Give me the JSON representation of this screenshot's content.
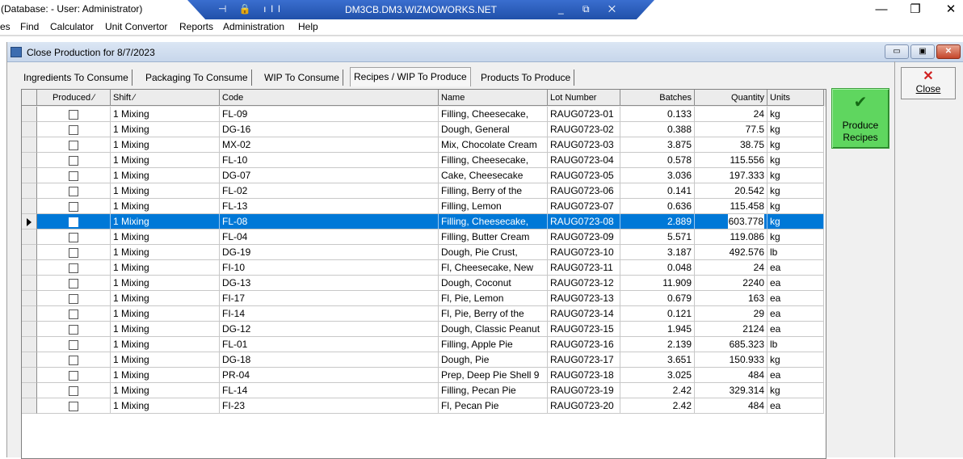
{
  "titlebar": {
    "text": "(Database:  - User: Administrator)",
    "remote_icons": "⊣ 🔒 ıll",
    "remote_host": "DM3CB.DM3.WIZMOWORKS.NET",
    "remote_controls": "_ ⧉ ✕",
    "minimize": "—",
    "restore": "❐",
    "close": "✕"
  },
  "menu": {
    "items": [
      "es",
      "Find",
      "Calculator",
      "Unit Convertor",
      "Reports",
      "Administration",
      "Help"
    ]
  },
  "child_window": {
    "title": "Close Production for 8/7/2023",
    "min": "▭",
    "max": "▣",
    "close": "✕"
  },
  "tabs": [
    {
      "label": "Ingredients To Consume"
    },
    {
      "label": "Packaging To Consume"
    },
    {
      "label": "WIP To Consume"
    },
    {
      "label": "Recipes / WIP To Produce"
    },
    {
      "label": "Products To Produce"
    }
  ],
  "grid": {
    "headers": {
      "produced": "Produced",
      "shift": "Shift",
      "code": "Code",
      "name": "Name",
      "lot": "Lot Number",
      "batches": "Batches",
      "quantity": "Quantity",
      "units": "Units"
    },
    "sort_glyph": "∕",
    "rows": [
      {
        "shift": "1 Mixing",
        "code": "FL-09",
        "name": "Filling, Cheesecake,",
        "lot": "RAUG0723-01",
        "batches": "0.133",
        "qty": "24",
        "units": "kg"
      },
      {
        "shift": "1 Mixing",
        "code": "DG-16",
        "name": "Dough, General",
        "lot": "RAUG0723-02",
        "batches": "0.388",
        "qty": "77.5",
        "units": "kg"
      },
      {
        "shift": "1 Mixing",
        "code": "MX-02",
        "name": "Mix, Chocolate Cream",
        "lot": "RAUG0723-03",
        "batches": "3.875",
        "qty": "38.75",
        "units": "kg"
      },
      {
        "shift": "1 Mixing",
        "code": "FL-10",
        "name": "Filling, Cheesecake,",
        "lot": "RAUG0723-04",
        "batches": "0.578",
        "qty": "115.556",
        "units": "kg"
      },
      {
        "shift": "1 Mixing",
        "code": "DG-07",
        "name": "Cake, Cheesecake",
        "lot": "RAUG0723-05",
        "batches": "3.036",
        "qty": "197.333",
        "units": "kg"
      },
      {
        "shift": "1 Mixing",
        "code": "FL-02",
        "name": "Filling, Berry of the",
        "lot": "RAUG0723-06",
        "batches": "0.141",
        "qty": "20.542",
        "units": "kg"
      },
      {
        "shift": "1 Mixing",
        "code": "FL-13",
        "name": "Filling, Lemon",
        "lot": "RAUG0723-07",
        "batches": "0.636",
        "qty": "115.458",
        "units": "kg"
      },
      {
        "shift": "1 Mixing",
        "code": "FL-08",
        "name": "Filling, Cheesecake,",
        "lot": "RAUG0723-08",
        "batches": "2.889",
        "qty": "603.778",
        "units": "kg",
        "selected": true
      },
      {
        "shift": "1 Mixing",
        "code": "FL-04",
        "name": "Filling, Butter Cream",
        "lot": "RAUG0723-09",
        "batches": "5.571",
        "qty": "119.086",
        "units": "kg"
      },
      {
        "shift": "1 Mixing",
        "code": "DG-19",
        "name": "Dough, Pie Crust,",
        "lot": "RAUG0723-10",
        "batches": "3.187",
        "qty": "492.576",
        "units": "lb"
      },
      {
        "shift": "1 Mixing",
        "code": "FI-10",
        "name": "Fl, Cheesecake, New",
        "lot": "RAUG0723-11",
        "batches": "0.048",
        "qty": "24",
        "units": "ea"
      },
      {
        "shift": "1 Mixing",
        "code": "DG-13",
        "name": "Dough, Coconut",
        "lot": "RAUG0723-12",
        "batches": "11.909",
        "qty": "2240",
        "units": "ea"
      },
      {
        "shift": "1 Mixing",
        "code": "FI-17",
        "name": "Fl, Pie, Lemon",
        "lot": "RAUG0723-13",
        "batches": "0.679",
        "qty": "163",
        "units": "ea"
      },
      {
        "shift": "1 Mixing",
        "code": "FI-14",
        "name": "Fl, Pie, Berry of the",
        "lot": "RAUG0723-14",
        "batches": "0.121",
        "qty": "29",
        "units": "ea"
      },
      {
        "shift": "1 Mixing",
        "code": "DG-12",
        "name": "Dough, Classic Peanut",
        "lot": "RAUG0723-15",
        "batches": "1.945",
        "qty": "2124",
        "units": "ea"
      },
      {
        "shift": "1 Mixing",
        "code": "FL-01",
        "name": "Filling, Apple Pie",
        "lot": "RAUG0723-16",
        "batches": "2.139",
        "qty": "685.323",
        "units": "lb"
      },
      {
        "shift": "1 Mixing",
        "code": "DG-18",
        "name": "Dough, Pie",
        "lot": "RAUG0723-17",
        "batches": "3.651",
        "qty": "150.933",
        "units": "kg"
      },
      {
        "shift": "1 Mixing",
        "code": "PR-04",
        "name": "Prep, Deep Pie Shell 9",
        "lot": "RAUG0723-18",
        "batches": "3.025",
        "qty": "484",
        "units": "ea"
      },
      {
        "shift": "1 Mixing",
        "code": "FL-14",
        "name": "Filling, Pecan Pie",
        "lot": "RAUG0723-19",
        "batches": "2.42",
        "qty": "329.314",
        "units": "kg"
      },
      {
        "shift": "1 Mixing",
        "code": "FI-23",
        "name": "Fl, Pecan Pie",
        "lot": "RAUG0723-20",
        "batches": "2.42",
        "qty": "484",
        "units": "ea"
      }
    ]
  },
  "buttons": {
    "close_label": "Close",
    "close_icon": "✕",
    "produce_label_1": "Produce",
    "produce_label_2": "Recipes",
    "produce_icon": "✔"
  },
  "colors": {
    "selection": "#0078d7",
    "produce_button": "#5fd65f",
    "remote_bar": "#1f4fa8"
  }
}
